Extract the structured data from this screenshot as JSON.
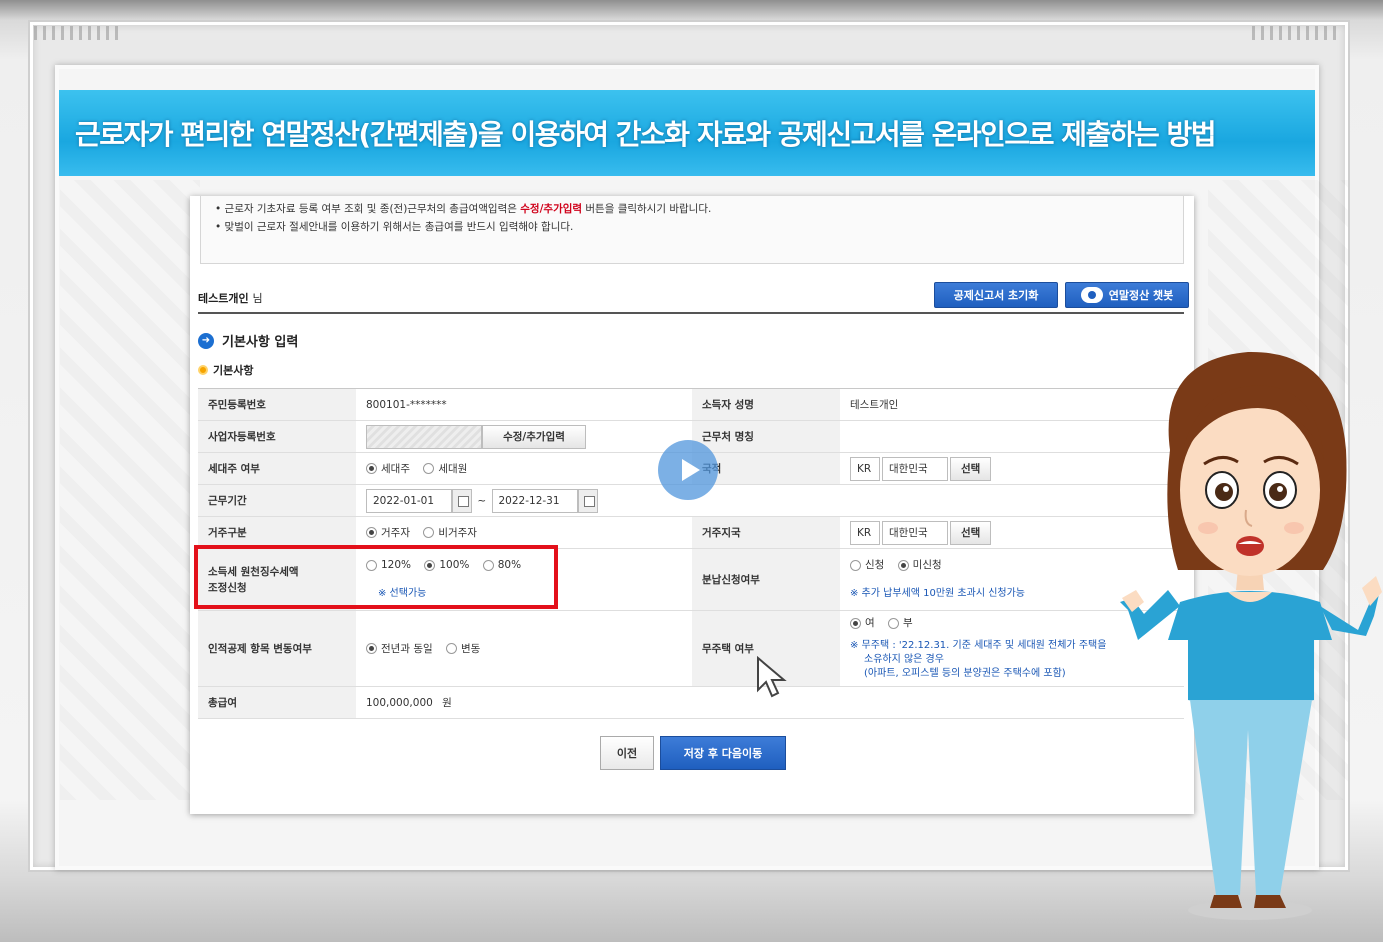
{
  "title": "근로자가 편리한 연말정산(간편제출)을 이용하여 간소화 자료와 공제신고서를 온라인으로 제출하는 방법",
  "notice": {
    "line1_prefix": "• 근로자 기초자료 등록 여부 조회 및 종(전)근무처의 총급여액입력은 ",
    "line1_highlight": "수정/추가입력",
    "line1_suffix": " 버튼을 클릭하시기 바랍니다.",
    "line2": "• 맞벌이 근로자 절세안내를 이용하기 위해서는 총급여를 반드시 입력해야 합니다."
  },
  "user": {
    "name": "테스트개인",
    "suffix": "님"
  },
  "buttons": {
    "reset": "공제신고서 초기화",
    "chatbot": "연말정산 챗봇",
    "edit_add": "수정/추가입력",
    "select": "선택",
    "prev": "이전",
    "save_next": "저장 후 다음이동"
  },
  "section_title": "기본사항 입력",
  "sub_title": "기본사항",
  "form": {
    "resident_no_label": "주민등록번호",
    "resident_no_value": "800101-*******",
    "income_owner_label": "소득자 성명",
    "income_owner_value": "테스트개인",
    "biz_no_label": "사업자등록번호",
    "workplace_label": "근무처 명칭",
    "head_label": "세대주 여부",
    "head_options": [
      "세대주",
      "세대원"
    ],
    "nationality_label": "국적",
    "nationality_code": "KR",
    "nationality_name": "대한민국",
    "period_label": "근무기간",
    "period_start": "2022-01-01",
    "period_sep": "~",
    "period_end": "2022-12-31",
    "residence_label": "거주구분",
    "residence_options": [
      "거주자",
      "비거주자"
    ],
    "residence_country_label": "거주지국",
    "residence_country_code": "KR",
    "residence_country_name": "대한민국",
    "withholding_label_1": "소득세 원천징수세액",
    "withholding_label_2": "조정신청",
    "withholding_options": [
      "120%",
      "100%",
      "80%"
    ],
    "withholding_note": "※ 선택가능",
    "installment_label": "분납신청여부",
    "installment_options": [
      "신청",
      "미신청"
    ],
    "installment_note": "※ 추가 납부세액 10만원 초과시 신청가능",
    "personal_label": "인적공제 항목 변동여부",
    "personal_options": [
      "전년과 동일",
      "변동"
    ],
    "homeless_label": "무주택 여부",
    "homeless_options": [
      "여",
      "부"
    ],
    "homeless_note_1": "※ 무주택 : '22.12.31. 기준 세대주 및 세대원 전체가 주택을",
    "homeless_note_2": "소유하지 않은 경우",
    "homeless_note_3": "(아파트, 오피스텔 등의 분양권은 주택수에 포함)",
    "total_pay_label": "총급여",
    "total_pay_value": "100,000,000",
    "total_pay_unit": "원"
  },
  "selected": {
    "head": 0,
    "residence": 0,
    "withholding": 1,
    "installment": 1,
    "personal": 0,
    "homeless": 0
  },
  "colors": {
    "banner": "#1aa7e0",
    "primary_button": "#1f5fbf",
    "highlight_box": "#e3101a",
    "note_blue": "#1a57b5",
    "notice_red": "#d0021b"
  },
  "icons": [
    "play-icon",
    "cursor-icon",
    "arrow-circle-icon",
    "calendar-icon",
    "chatbot-icon"
  ]
}
